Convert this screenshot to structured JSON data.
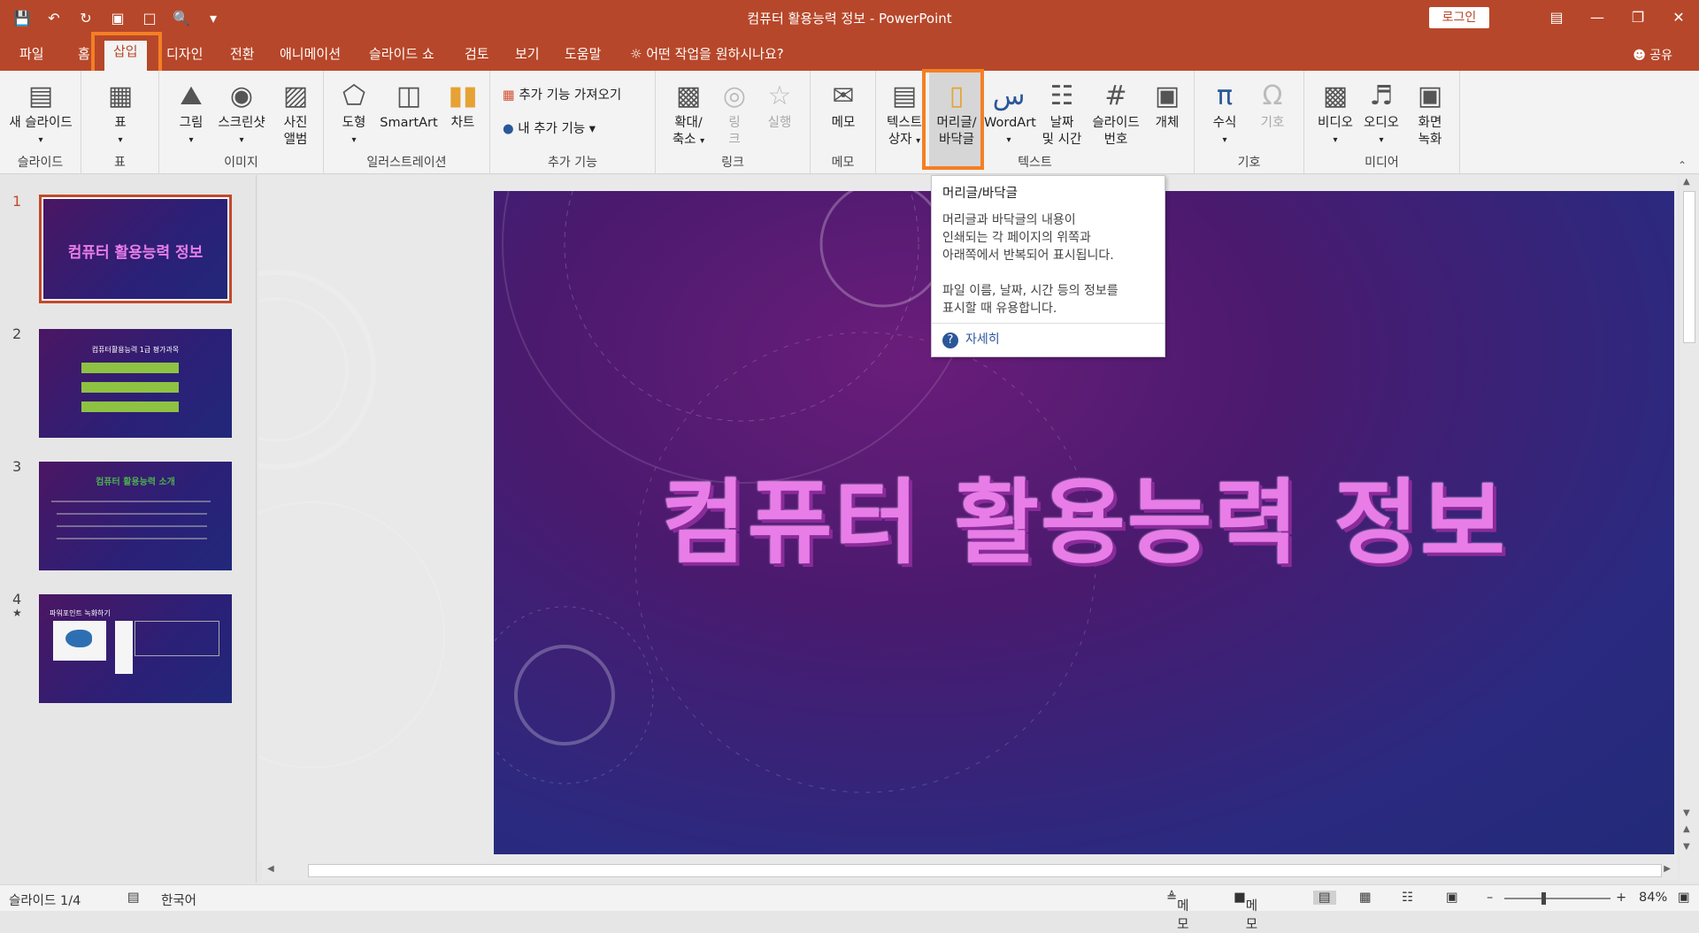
{
  "window": {
    "title": "컴퓨터 활용능력 정보 - PowerPoint",
    "login_label": "로그인"
  },
  "qat": {
    "icons": [
      "save-icon",
      "undo-icon",
      "redo-icon",
      "present-icon",
      "new-icon",
      "preview-icon",
      "customize-icon"
    ]
  },
  "tabs": [
    {
      "label": "파일"
    },
    {
      "label": "홈"
    },
    {
      "label": "삽입"
    },
    {
      "label": "디자인"
    },
    {
      "label": "전환"
    },
    {
      "label": "애니메이션"
    },
    {
      "label": "슬라이드 쇼"
    },
    {
      "label": "검토"
    },
    {
      "label": "보기"
    },
    {
      "label": "도움말"
    }
  ],
  "tell_me": "어떤 작업을 원하시나요?",
  "share": "공유",
  "ribbon": {
    "slides": {
      "group": "슬라이드",
      "new_slide": "새 슬라이드"
    },
    "tables": {
      "group": "표",
      "table": "표"
    },
    "images": {
      "group": "이미지",
      "picture": "그림",
      "screenshot": "스크린샷",
      "album1": "사진",
      "album2": "앨범"
    },
    "illustrations": {
      "group": "일러스트레이션",
      "shapes": "도형",
      "smartart": "SmartArt",
      "chart": "차트"
    },
    "addins": {
      "group": "추가 기능",
      "get": "추가 기능 가져오기",
      "my": "내 추가 기능"
    },
    "links": {
      "group": "링크",
      "zoom1": "확대/",
      "zoom2": "축소",
      "link1": "링",
      "link2": "크",
      "action": "실행"
    },
    "comments": {
      "group": "메모",
      "comment": "메모"
    },
    "text": {
      "group": "텍스트",
      "textbox1": "텍스트",
      "textbox2": "상자",
      "hf1": "머리글/",
      "hf2": "바닥글",
      "wordart": "WordArt",
      "dt1": "날짜",
      "dt2": "및 시간",
      "sn1": "슬라이드",
      "sn2": "번호",
      "object": "개체"
    },
    "symbols": {
      "group": "기호",
      "equation": "수식",
      "symbol": "기호"
    },
    "media": {
      "group": "미디어",
      "video": "비디오",
      "audio": "오디오",
      "rec1": "화면",
      "rec2": "녹화"
    }
  },
  "tooltip": {
    "title": "머리글/바닥글",
    "line1": "머리글과 바닥글의 내용이",
    "line2": "인쇄되는 각 페이지의 위쪽과",
    "line3": "아래쪽에서 반복되어 표시됩니다.",
    "line4": "파일 이름, 날짜, 시간 등의 정보를",
    "line5": "표시할 때 유용합니다.",
    "more": "자세히"
  },
  "thumbnails": [
    {
      "num": "1",
      "title": "컴퓨터 활용능력 정보"
    },
    {
      "num": "2",
      "title": "컴퓨터활용능력 1급 평가과목",
      "items": [
        "",
        "",
        ""
      ]
    },
    {
      "num": "3",
      "title": "컴퓨터 활용능력 소개"
    },
    {
      "num": "4",
      "title": "파워포인트 녹화하기"
    }
  ],
  "slide": {
    "title": "컴퓨터 활용능력 정보"
  },
  "status": {
    "slide_pos": "슬라이드 1/4",
    "language": "한국어",
    "notes": "메모",
    "comments": "메모",
    "zoom": "84%"
  },
  "colors": {
    "accent": "#b7472a",
    "highlight": "#f47f24"
  }
}
